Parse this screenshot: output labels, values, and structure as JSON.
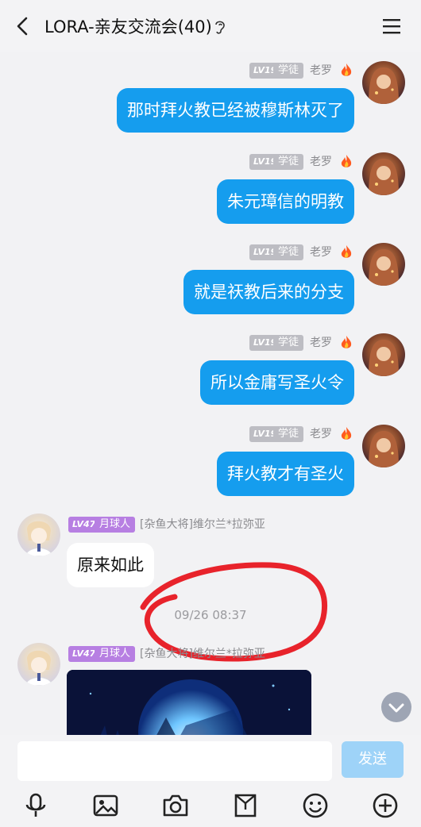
{
  "header": {
    "title": "LORA-亲友交流会(40)"
  },
  "messages_right": [
    {
      "level": "LV19",
      "role": "学徒",
      "nick": "老罗",
      "text": "那时拜火教已经被穆斯林灭了"
    },
    {
      "level": "LV19",
      "role": "学徒",
      "nick": "老罗",
      "text": "朱元璋信的明教"
    },
    {
      "level": "LV19",
      "role": "学徒",
      "nick": "老罗",
      "text": "就是祆教后来的分支"
    },
    {
      "level": "LV19",
      "role": "学徒",
      "nick": "老罗",
      "text": "所以金庸写圣火令"
    },
    {
      "level": "LV19",
      "role": "学徒",
      "nick": "老罗",
      "text": "拜火教才有圣火"
    }
  ],
  "messages_left": [
    {
      "level": "LV47",
      "role": "月球人",
      "nick": "[杂鱼大将]维尔兰*拉弥亚",
      "text": "原来如此"
    },
    {
      "level": "LV47",
      "role": "月球人",
      "nick": "[杂鱼大将]维尔兰*拉弥亚",
      "text": ""
    }
  ],
  "timestamp": "09/26 08:37",
  "composer": {
    "placeholder": "",
    "send_label": "发送"
  },
  "toolbar": [
    "microphone-icon",
    "image-icon",
    "camera-icon",
    "file-icon",
    "emoji-icon",
    "plus-icon"
  ],
  "colors": {
    "bubble_blue": "#159dee",
    "background": "#f2f2f4",
    "badge_purple": "#b77fe2",
    "badge_gray": "#bdbdc3",
    "send_disabled": "#9ed3f8",
    "annotation_red": "#e8232b"
  }
}
